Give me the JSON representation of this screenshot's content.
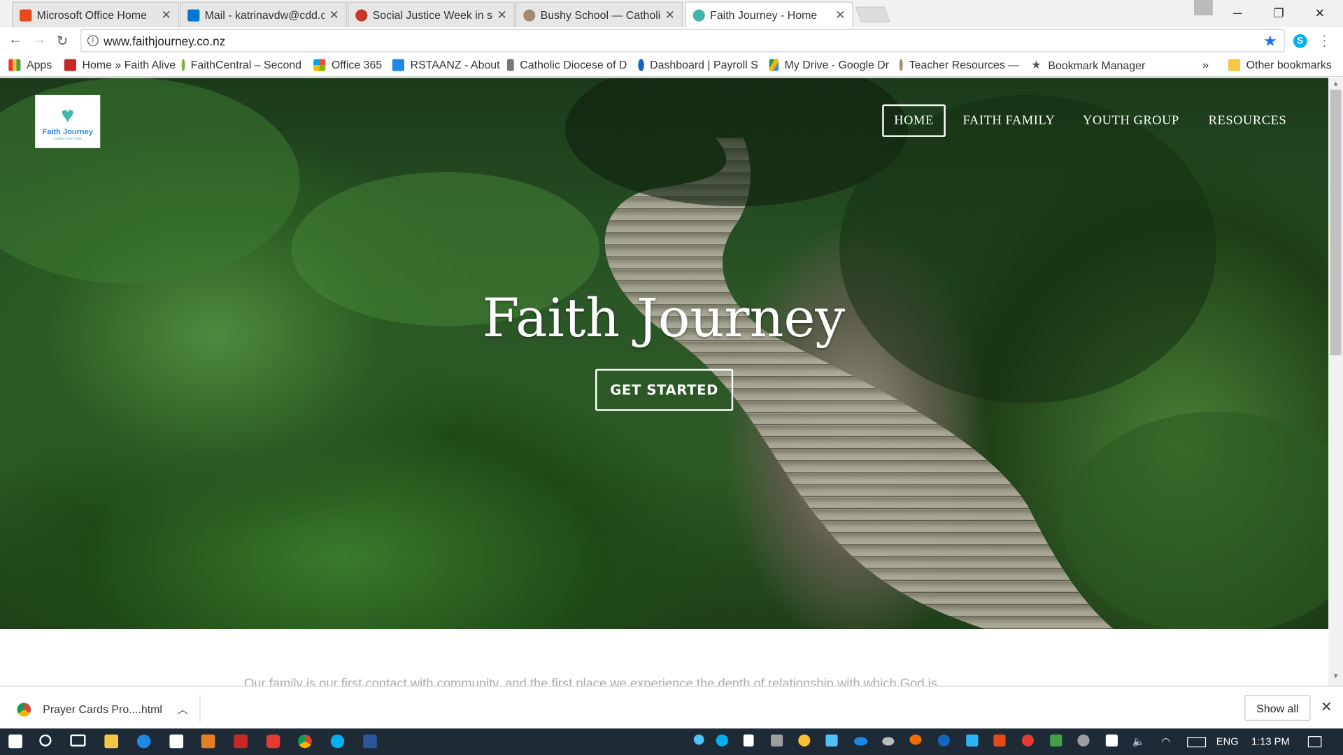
{
  "browser": {
    "tabs": [
      {
        "title": "Microsoft Office Home",
        "color": "#e64a19"
      },
      {
        "title": "Mail - katrinavdw@cdd.c",
        "color": "#0078d4"
      },
      {
        "title": "Social Justice Week in sc",
        "color": "#c0392b"
      },
      {
        "title": "Bushy School — Catholic",
        "color": "#a38b6d"
      },
      {
        "title": "Faith Journey - Home",
        "color": "#41b6a9"
      }
    ],
    "url": "www.faithjourney.co.nz",
    "bookmarks": [
      {
        "label": "Apps"
      },
      {
        "label": "Home » Faith Alive"
      },
      {
        "label": "FaithCentral – Second"
      },
      {
        "label": "Office 365"
      },
      {
        "label": "RSTAANZ - About"
      },
      {
        "label": "Catholic Diocese of D"
      },
      {
        "label": "Dashboard | Payroll S"
      },
      {
        "label": "My Drive - Google Dr"
      },
      {
        "label": "Teacher Resources —"
      },
      {
        "label": "Bookmark Manager"
      }
    ],
    "overflow": "»",
    "other_bookmarks": "Other bookmarks"
  },
  "site": {
    "logo_text": "Faith Journey",
    "logo_sub": "Awaken Your Faith",
    "nav": [
      "HOME",
      "FAITH FAMILY",
      "YOUTH GROUP",
      "RESOURCES"
    ],
    "hero_title": "Faith Journey",
    "cta": "GET STARTED",
    "intro": "Our family is our first contact with community, and the first place we experience the depth of relationship with which God is"
  },
  "downloads": {
    "file": "Prayer Cards Pro....html",
    "show_all": "Show all"
  },
  "taskbar": {
    "lang": "ENG",
    "time": "1:13 PM"
  },
  "colors": {
    "accent": "#1a73e8",
    "taskbar": "#1e2a36",
    "brand": "#41b6a9"
  }
}
